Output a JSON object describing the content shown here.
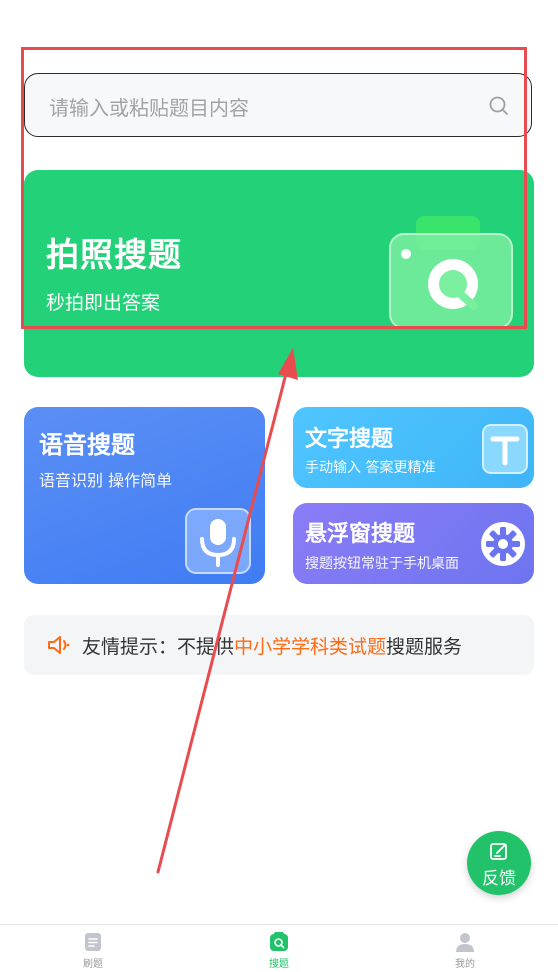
{
  "search": {
    "placeholder": "请输入或粘贴题目内容"
  },
  "photo_card": {
    "title": "拍照搜题",
    "subtitle": "秒拍即出答案"
  },
  "voice_card": {
    "title": "语音搜题",
    "subtitle": "语音识别 操作简单"
  },
  "text_card": {
    "title": "文字搜题",
    "subtitle": "手动输入 答案更精准"
  },
  "float_card": {
    "title": "悬浮窗搜题",
    "subtitle": "搜题按钮常驻于手机桌面"
  },
  "tip": {
    "prefix": "友情提示：不提供",
    "highlight": "中小学学科类试题",
    "suffix": "搜题服务"
  },
  "fab": {
    "label": "反馈"
  },
  "tabs": [
    {
      "label": "刷题",
      "icon": "document-icon",
      "active": false
    },
    {
      "label": "搜题",
      "icon": "search-tab-icon",
      "active": true
    },
    {
      "label": "我的",
      "icon": "user-icon",
      "active": false
    }
  ],
  "colors": {
    "primary_green": "#22c26b",
    "photo_card": "#22d178",
    "voice_card": "#4a84f4",
    "text_card": "#45bdfb",
    "float_card": "#7b78f3",
    "tip_highlight": "#ff6a13",
    "annotation_red": "#e94c4f"
  }
}
